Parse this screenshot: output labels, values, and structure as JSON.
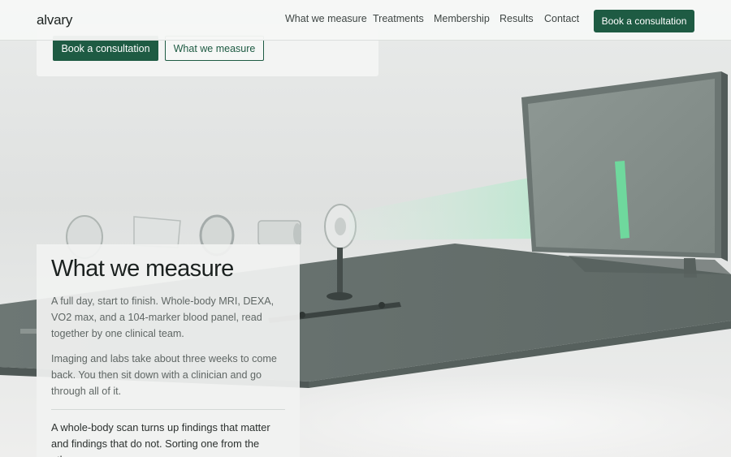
{
  "brand": {
    "logo": "alvary"
  },
  "nav": {
    "items": [
      {
        "label": "What we measure"
      },
      {
        "label": "Treatments"
      },
      {
        "label": "Membership"
      },
      {
        "label": "Results"
      },
      {
        "label": "Contact"
      }
    ],
    "cta": "Book a consultation"
  },
  "hero": {
    "primary_cta": "Book a consultation",
    "secondary_cta": "What we measure"
  },
  "measure": {
    "title": "What we measure",
    "paragraph_1": "A full day, start to finish. Whole-body MRI, DEXA, VO2 max, and a 104-marker blood panel, read together by one clinical team.",
    "paragraph_2": "Imaging and labs take about three weeks to come back. You then sit down with a clinician and go through all of it.",
    "paragraph_3": "A whole-body scan turns up findings that matter and findings that do not. Sorting one from the other"
  },
  "colors": {
    "brand_green": "#1e5b43",
    "beam_green": "#8fe3b3"
  }
}
